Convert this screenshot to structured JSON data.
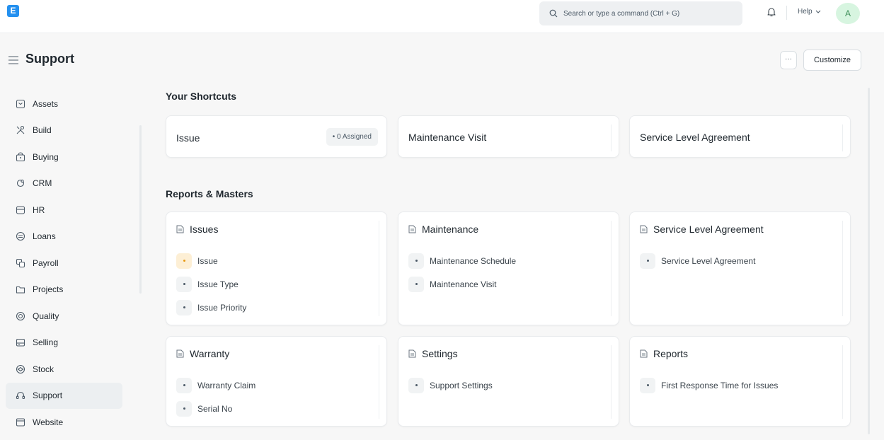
{
  "navbar": {
    "logo": "E",
    "search_placeholder": "Search or type a command (Ctrl + G)",
    "help_label": "Help",
    "avatar_initial": "A"
  },
  "page": {
    "title": "Support",
    "more_label": "···",
    "customize_label": "Customize"
  },
  "sidebar": {
    "items": [
      {
        "label": "Assets",
        "icon": "box-icon"
      },
      {
        "label": "Build",
        "icon": "tools-icon"
      },
      {
        "label": "Buying",
        "icon": "bag-icon"
      },
      {
        "label": "CRM",
        "icon": "crm-icon"
      },
      {
        "label": "HR",
        "icon": "hr-icon"
      },
      {
        "label": "Loans",
        "icon": "loan-icon"
      },
      {
        "label": "Payroll",
        "icon": "payroll-icon"
      },
      {
        "label": "Projects",
        "icon": "folder-icon"
      },
      {
        "label": "Quality",
        "icon": "quality-icon"
      },
      {
        "label": "Selling",
        "icon": "selling-icon"
      },
      {
        "label": "Stock",
        "icon": "stock-icon"
      },
      {
        "label": "Support",
        "icon": "headset-icon",
        "active": true
      },
      {
        "label": "Website",
        "icon": "website-icon"
      }
    ]
  },
  "shortcuts": {
    "title": "Your Shortcuts",
    "items": [
      {
        "label": "Issue",
        "badge": "• 0 Assigned"
      },
      {
        "label": "Maintenance Visit"
      },
      {
        "label": "Service Level Agreement"
      }
    ]
  },
  "reports": {
    "title": "Reports & Masters",
    "cards": [
      {
        "title": "Issues",
        "links": [
          "Issue",
          "Issue Type",
          "Issue Priority"
        ]
      },
      {
        "title": "Maintenance",
        "links": [
          "Maintenance Schedule",
          "Maintenance Visit"
        ]
      },
      {
        "title": "Service Level Agreement",
        "links": [
          "Service Level Agreement"
        ]
      },
      {
        "title": "Warranty",
        "links": [
          "Warranty Claim",
          "Serial No"
        ]
      },
      {
        "title": "Settings",
        "links": [
          "Support Settings"
        ]
      },
      {
        "title": "Reports",
        "links": [
          "First Response Time for Issues"
        ]
      }
    ]
  },
  "colors": {
    "brand": "#2490ef",
    "warning_dot": "#e79913",
    "active_item_bg": "#eceff1"
  }
}
